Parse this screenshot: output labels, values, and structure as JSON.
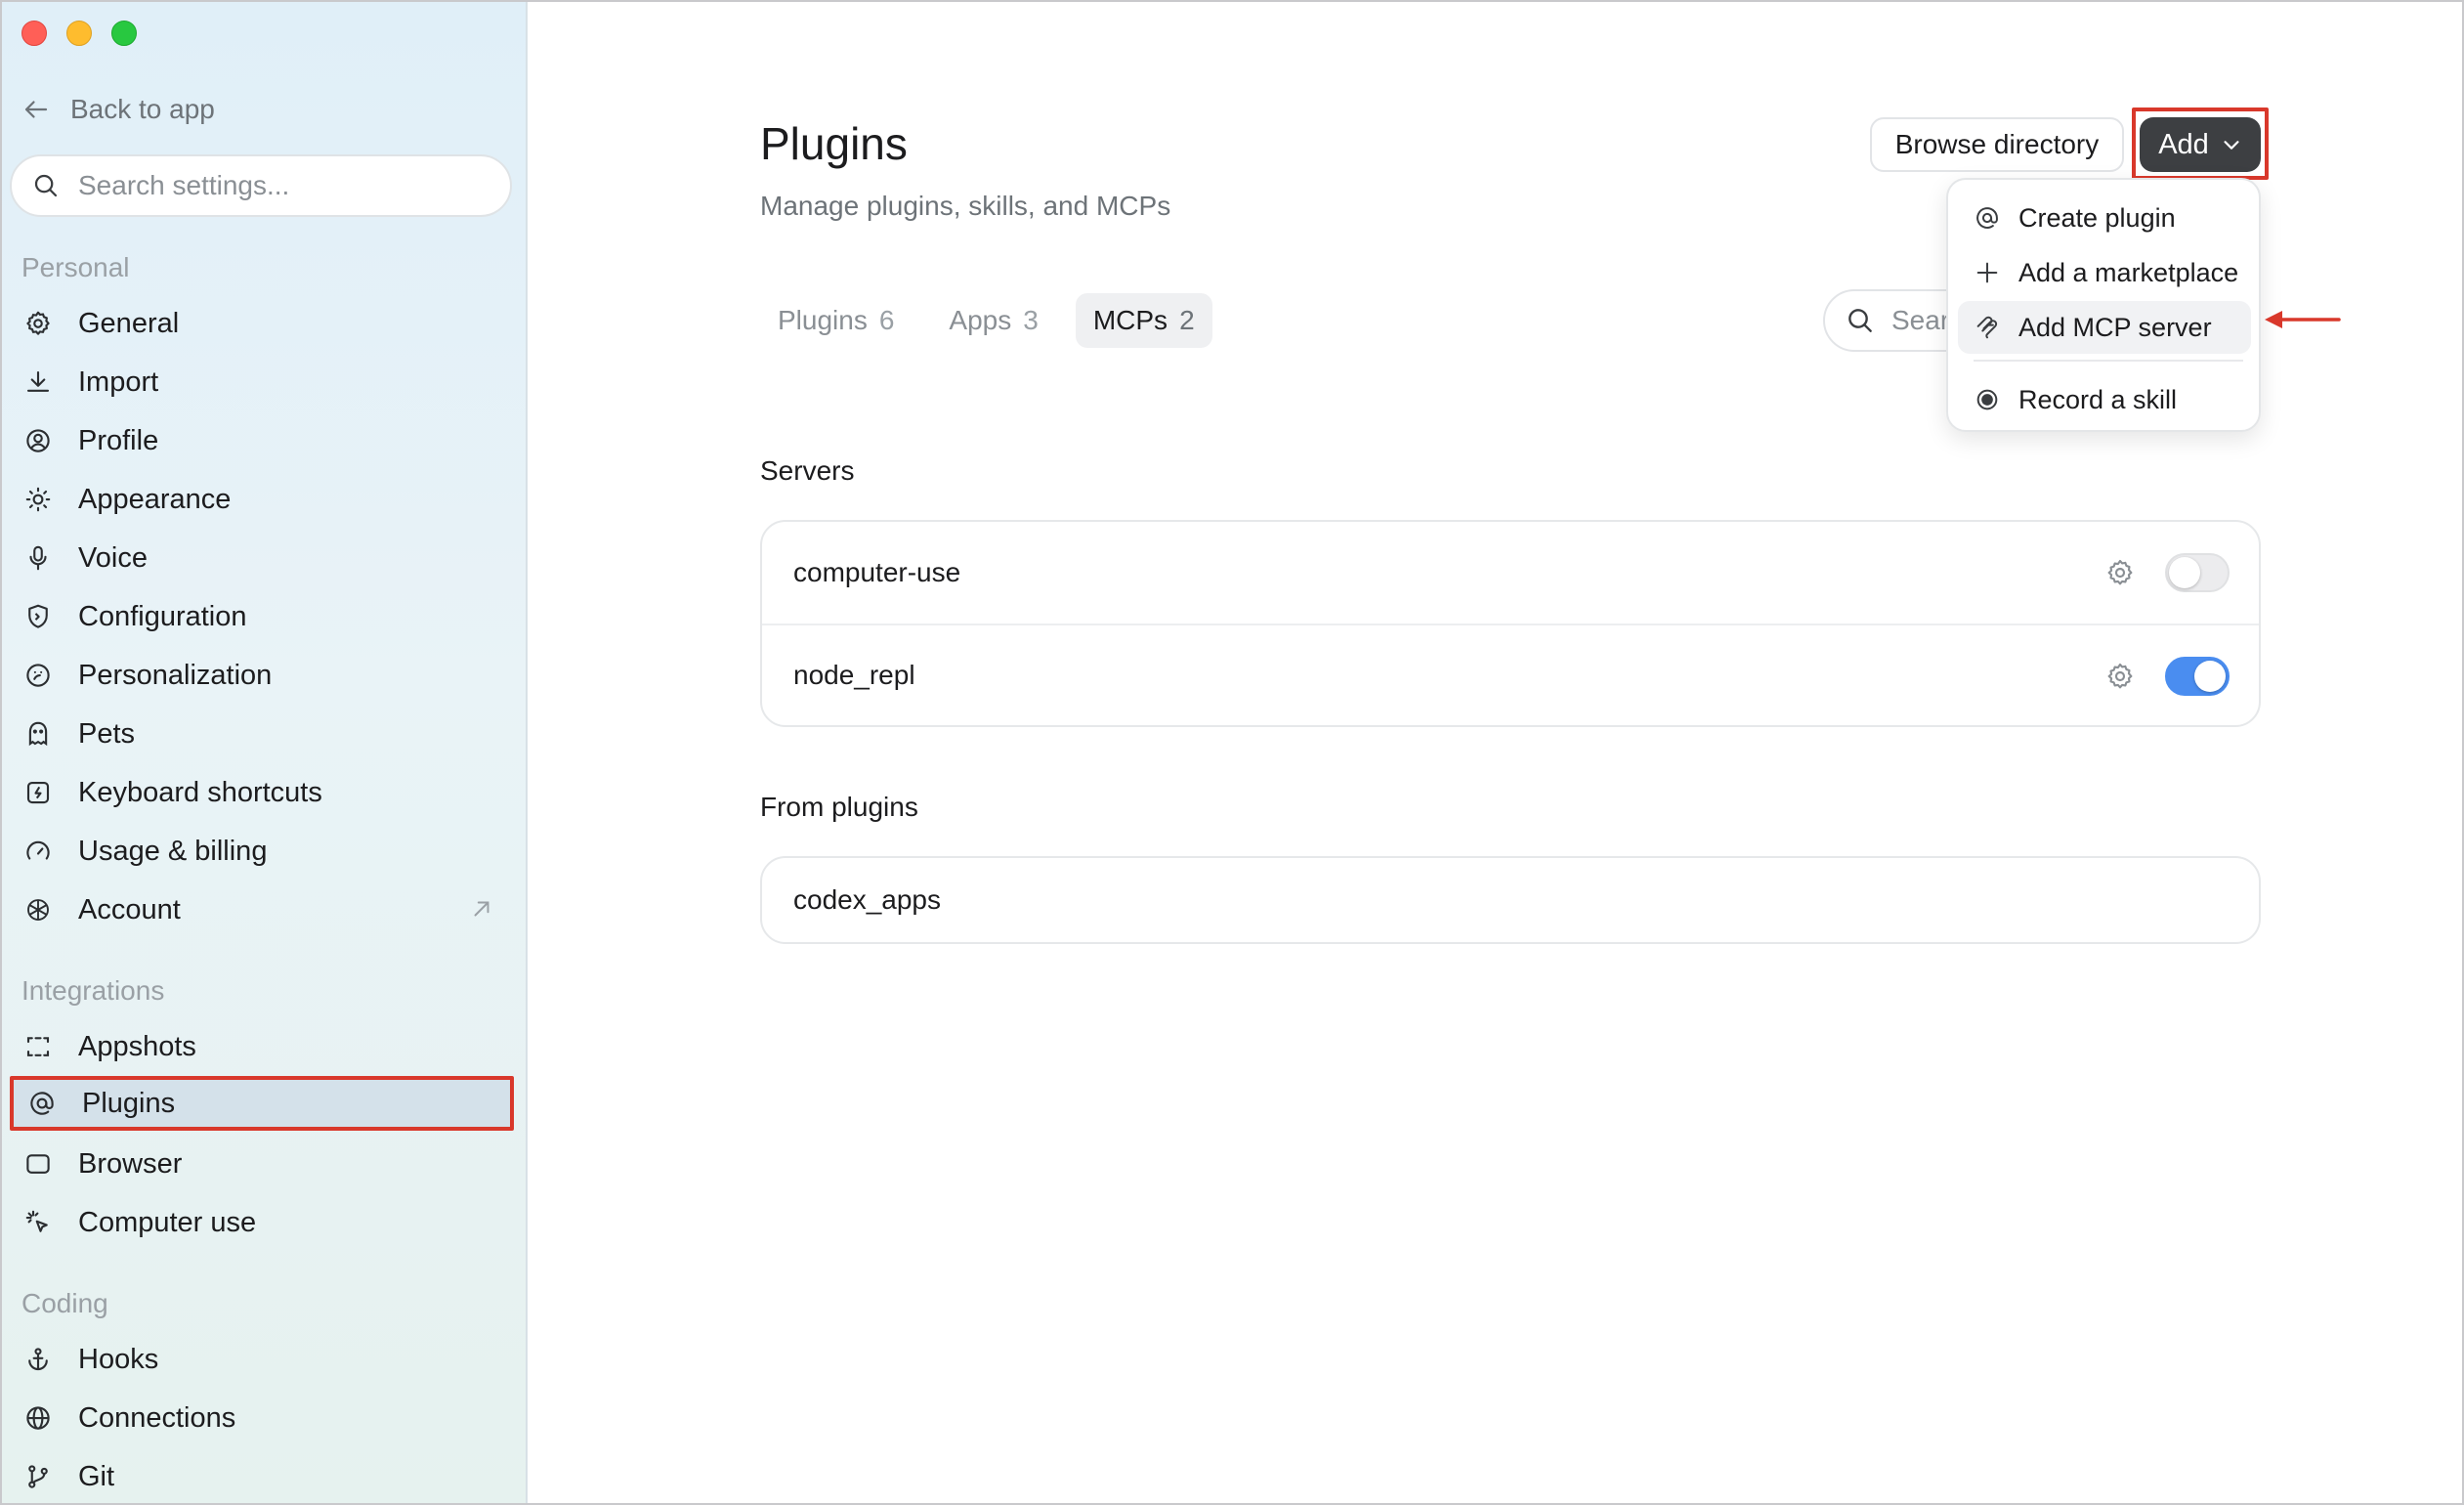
{
  "sidebar": {
    "back_label": "Back to app",
    "search_placeholder": "Search settings...",
    "sections": {
      "personal": "Personal",
      "integrations": "Integrations",
      "coding": "Coding"
    },
    "personal_items": [
      {
        "label": "General",
        "icon": "gear-icon"
      },
      {
        "label": "Import",
        "icon": "download-icon"
      },
      {
        "label": "Profile",
        "icon": "user-circle-icon"
      },
      {
        "label": "Appearance",
        "icon": "sun-icon"
      },
      {
        "label": "Voice",
        "icon": "microphone-icon"
      },
      {
        "label": "Configuration",
        "icon": "shield-icon"
      },
      {
        "label": "Personalization",
        "icon": "personalization-icon"
      },
      {
        "label": "Pets",
        "icon": "pet-icon"
      },
      {
        "label": "Keyboard shortcuts",
        "icon": "keyboard-icon"
      },
      {
        "label": "Usage & billing",
        "icon": "gauge-icon"
      },
      {
        "label": "Account",
        "icon": "openai-icon"
      }
    ],
    "integration_items": [
      {
        "label": "Appshots",
        "icon": "screenshot-icon"
      },
      {
        "label": "Plugins",
        "icon": "at-icon"
      },
      {
        "label": "Browser",
        "icon": "browser-icon"
      },
      {
        "label": "Computer use",
        "icon": "cursor-click-icon"
      }
    ],
    "coding_items": [
      {
        "label": "Hooks",
        "icon": "anchor-icon"
      },
      {
        "label": "Connections",
        "icon": "globe-icon"
      },
      {
        "label": "Git",
        "icon": "branch-icon"
      }
    ]
  },
  "main": {
    "title": "Plugins",
    "subtitle": "Manage plugins, skills, and MCPs",
    "browse_label": "Browse directory",
    "add_label": "Add",
    "search_placeholder": "Search",
    "tabs": [
      {
        "label": "Plugins",
        "count": "6"
      },
      {
        "label": "Apps",
        "count": "3"
      },
      {
        "label": "MCPs",
        "count": "2"
      }
    ],
    "servers_label": "Servers",
    "servers": [
      {
        "name": "computer-use",
        "enabled": false
      },
      {
        "name": "node_repl",
        "enabled": true
      }
    ],
    "from_plugins_label": "From plugins",
    "from_plugins": [
      {
        "name": "codex_apps"
      }
    ]
  },
  "add_menu": {
    "items": [
      {
        "label": "Create plugin",
        "icon": "at-icon"
      },
      {
        "label": "Add a marketplace",
        "icon": "plus-icon"
      },
      {
        "label": "Add MCP server",
        "icon": "mcp-icon"
      },
      {
        "label": "Record a skill",
        "icon": "record-icon"
      }
    ]
  },
  "colors": {
    "highlight": "#d9382b",
    "toggle_on": "#4a8df0",
    "add_button": "#3d3f42"
  }
}
